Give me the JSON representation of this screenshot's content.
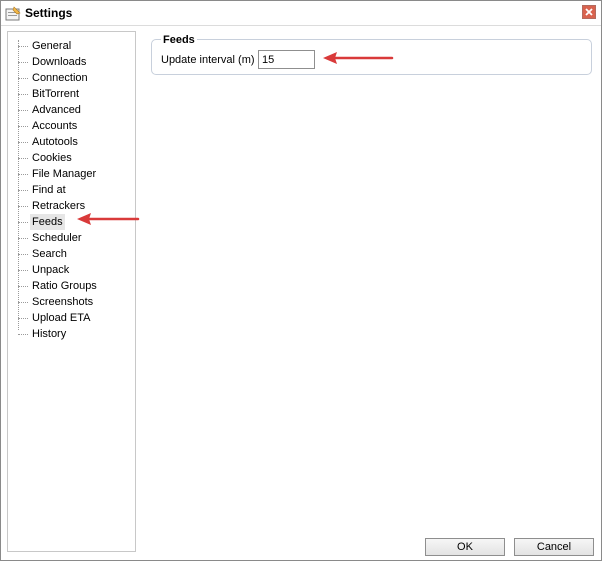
{
  "window": {
    "title": "Settings",
    "app_icon": "settings-app-icon",
    "close_icon": "close-icon"
  },
  "sidebar": {
    "selected": "Feeds",
    "items": [
      {
        "label": "General"
      },
      {
        "label": "Downloads"
      },
      {
        "label": "Connection"
      },
      {
        "label": "BitTorrent"
      },
      {
        "label": "Advanced"
      },
      {
        "label": "Accounts"
      },
      {
        "label": "Autotools"
      },
      {
        "label": "Cookies"
      },
      {
        "label": "File Manager"
      },
      {
        "label": "Find at"
      },
      {
        "label": "Retrackers"
      },
      {
        "label": "Feeds"
      },
      {
        "label": "Scheduler"
      },
      {
        "label": "Search"
      },
      {
        "label": "Unpack"
      },
      {
        "label": "Ratio Groups"
      },
      {
        "label": "Screenshots"
      },
      {
        "label": "Upload ETA"
      },
      {
        "label": "History"
      }
    ]
  },
  "feeds": {
    "group_title": "Feeds",
    "update_interval_label": "Update interval (m)",
    "update_interval_value": "15"
  },
  "buttons": {
    "ok_label": "OK",
    "cancel_label": "Cancel"
  },
  "colors": {
    "annotation_arrow": "#d93a3a",
    "selection_bg": "#e6e6e6"
  }
}
